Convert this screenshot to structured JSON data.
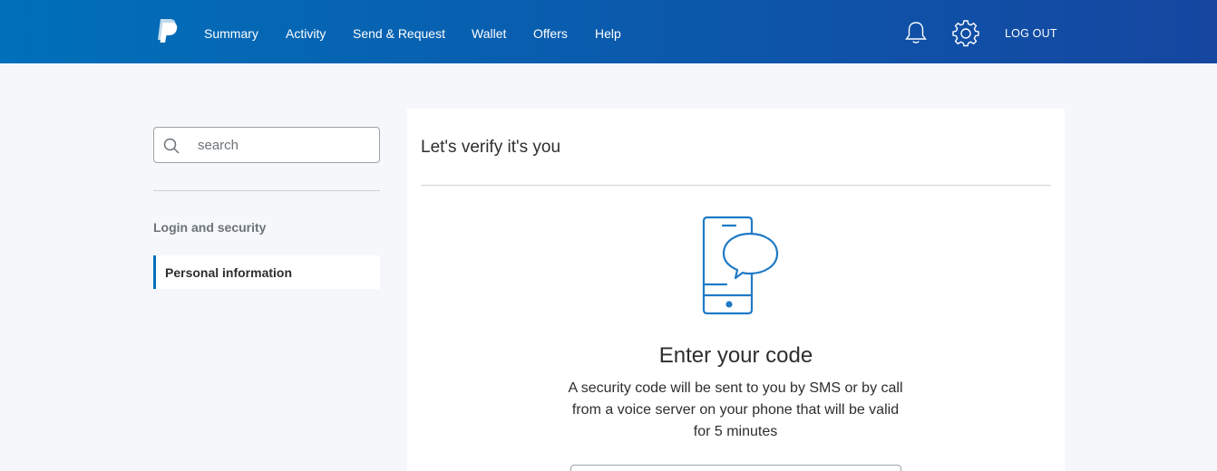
{
  "header": {
    "logo_icon": "paypal-logo-icon",
    "nav": [
      {
        "label": "Summary"
      },
      {
        "label": "Activity"
      },
      {
        "label": "Send & Request"
      },
      {
        "label": "Wallet"
      },
      {
        "label": "Offers"
      },
      {
        "label": "Help"
      }
    ],
    "notifications_icon": "bell-icon",
    "settings_icon": "gear-icon",
    "logout_label": "LOG OUT",
    "gradient_start": "#0070ba",
    "gradient_end": "#1546a0"
  },
  "sidebar": {
    "search": {
      "placeholder": "search",
      "value": "",
      "icon": "search-icon"
    },
    "heading": "Login and security",
    "items": [
      {
        "label": "Personal information",
        "active": true
      }
    ],
    "accent_color": "#0070ba"
  },
  "main": {
    "title": "Let's verify it's you",
    "illustration_icon": "phone-message-icon",
    "code_heading": "Enter your code",
    "code_description": "A security code will be sent to you by SMS or by call from a voice server on your phone that will be valid for 5 minutes",
    "icon_color": "#1f7ac5"
  }
}
